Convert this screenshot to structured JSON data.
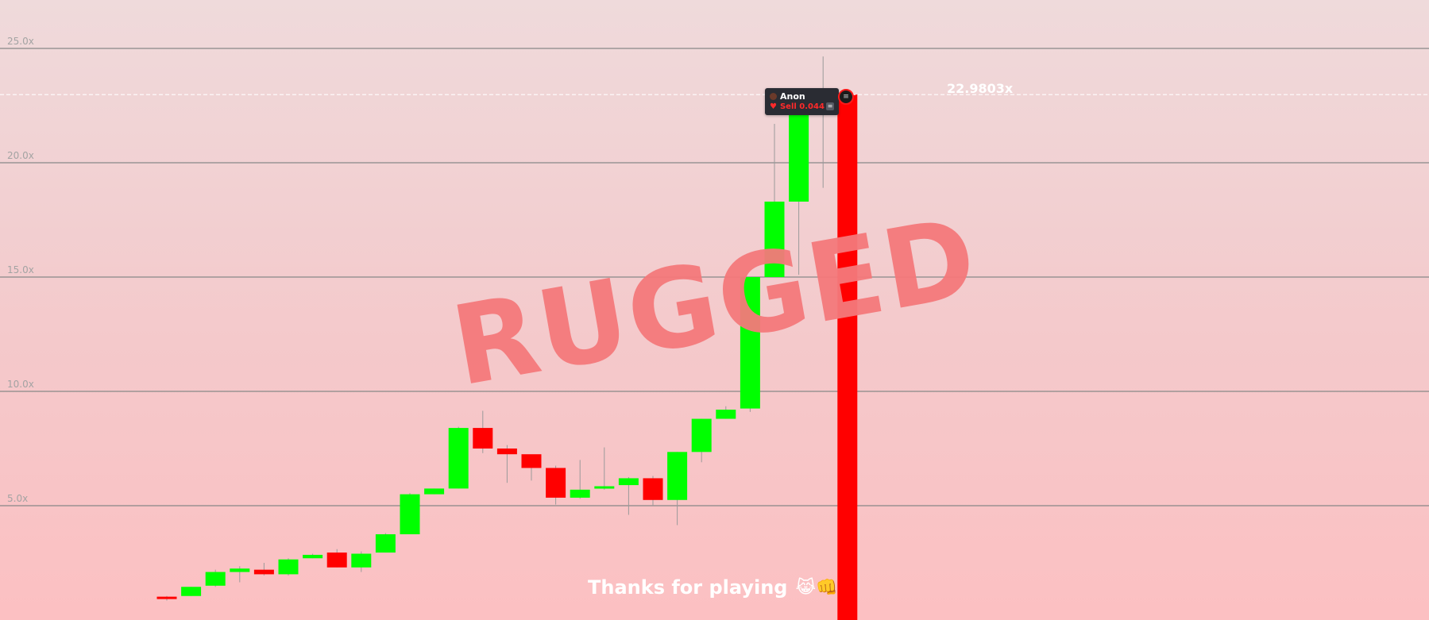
{
  "chart_data": {
    "type": "candlestick",
    "ylim": [
      0,
      27
    ],
    "yticks": [
      5,
      10,
      15,
      20,
      25
    ],
    "ytick_labels": [
      "5.0x",
      "10.0x",
      "15.0x",
      "20.0x",
      "25.0x"
    ],
    "grid": true,
    "current_value": 22.9803,
    "current_label": "22.9803x",
    "candles": [
      {
        "open": 1.02,
        "close": 1.0,
        "high": 1.05,
        "low": 0.85
      },
      {
        "open": 1.05,
        "close": 1.45,
        "high": 1.45,
        "low": 1.05
      },
      {
        "open": 1.5,
        "close": 2.1,
        "high": 2.2,
        "low": 1.45
      },
      {
        "open": 2.1,
        "close": 2.25,
        "high": 2.35,
        "low": 1.65
      },
      {
        "open": 2.2,
        "close": 2.0,
        "high": 2.5,
        "low": 1.95
      },
      {
        "open": 2.0,
        "close": 2.65,
        "high": 2.7,
        "low": 1.95
      },
      {
        "open": 2.7,
        "close": 2.85,
        "high": 2.9,
        "low": 2.7
      },
      {
        "open": 2.95,
        "close": 2.3,
        "high": 3.1,
        "low": 2.3
      },
      {
        "open": 2.3,
        "close": 2.9,
        "high": 3.0,
        "low": 2.1
      },
      {
        "open": 2.95,
        "close": 3.75,
        "high": 3.8,
        "low": 2.95
      },
      {
        "open": 3.75,
        "close": 5.5,
        "high": 5.55,
        "low": 3.75
      },
      {
        "open": 5.5,
        "close": 5.75,
        "high": 5.75,
        "low": 5.5
      },
      {
        "open": 5.75,
        "close": 8.4,
        "high": 8.45,
        "low": 5.75
      },
      {
        "open": 8.4,
        "close": 7.5,
        "high": 9.15,
        "low": 7.3
      },
      {
        "open": 7.5,
        "close": 7.25,
        "high": 7.65,
        "low": 6.0
      },
      {
        "open": 7.25,
        "close": 6.65,
        "high": 7.2,
        "low": 6.1
      },
      {
        "open": 6.65,
        "close": 5.35,
        "high": 6.75,
        "low": 5.05
      },
      {
        "open": 5.35,
        "close": 5.7,
        "high": 7.0,
        "low": 5.3
      },
      {
        "open": 5.75,
        "close": 5.85,
        "high": 7.55,
        "low": 5.7
      },
      {
        "open": 5.9,
        "close": 6.2,
        "high": 6.25,
        "low": 4.6
      },
      {
        "open": 6.2,
        "close": 5.25,
        "high": 6.3,
        "low": 5.0
      },
      {
        "open": 5.25,
        "close": 7.35,
        "high": 7.35,
        "low": 4.15
      },
      {
        "open": 7.35,
        "close": 8.8,
        "high": 8.8,
        "low": 6.9
      },
      {
        "open": 8.8,
        "close": 9.2,
        "high": 9.35,
        "low": 8.8
      },
      {
        "open": 9.25,
        "close": 15.0,
        "high": 15.0,
        "low": 9.1
      },
      {
        "open": 15.0,
        "close": 18.3,
        "high": 21.7,
        "low": 15.0
      },
      {
        "open": 18.3,
        "close": 22.6,
        "high": 22.9,
        "low": 15.1
      },
      {
        "open": 22.6,
        "close": 22.3,
        "high": 24.65,
        "low": 18.9
      },
      {
        "open": 22.98,
        "close": 0.0,
        "high": 22.98,
        "low": 0.0
      }
    ]
  },
  "overlay": {
    "rugged_text": "RUGGED",
    "thanks_text": "Thanks for playing",
    "thanks_emoji": "😹👊"
  },
  "trade_tag": {
    "name": "Anon",
    "sell_text": "Sell 0.044"
  },
  "colors": {
    "up": "#00ff00",
    "down": "#ff0000",
    "grid": "#888888",
    "current_line": "#ffffff",
    "rugged": "#f5797b"
  }
}
